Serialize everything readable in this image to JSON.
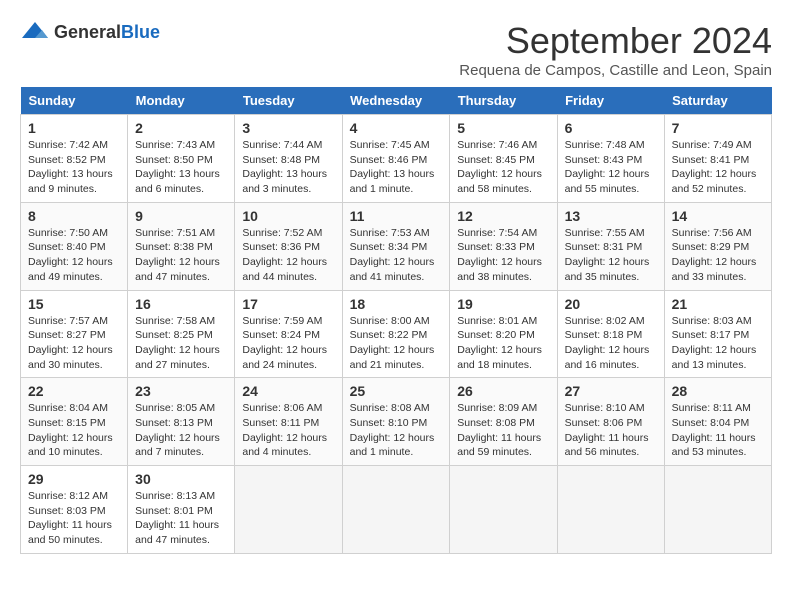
{
  "header": {
    "logo_general": "General",
    "logo_blue": "Blue",
    "month_title": "September 2024",
    "subtitle": "Requena de Campos, Castille and Leon, Spain"
  },
  "columns": [
    "Sunday",
    "Monday",
    "Tuesday",
    "Wednesday",
    "Thursday",
    "Friday",
    "Saturday"
  ],
  "weeks": [
    [
      {
        "day": "1",
        "sunrise": "7:42 AM",
        "sunset": "8:52 PM",
        "daylight": "13 hours and 9 minutes."
      },
      {
        "day": "2",
        "sunrise": "7:43 AM",
        "sunset": "8:50 PM",
        "daylight": "13 hours and 6 minutes."
      },
      {
        "day": "3",
        "sunrise": "7:44 AM",
        "sunset": "8:48 PM",
        "daylight": "13 hours and 3 minutes."
      },
      {
        "day": "4",
        "sunrise": "7:45 AM",
        "sunset": "8:46 PM",
        "daylight": "13 hours and 1 minute."
      },
      {
        "day": "5",
        "sunrise": "7:46 AM",
        "sunset": "8:45 PM",
        "daylight": "12 hours and 58 minutes."
      },
      {
        "day": "6",
        "sunrise": "7:48 AM",
        "sunset": "8:43 PM",
        "daylight": "12 hours and 55 minutes."
      },
      {
        "day": "7",
        "sunrise": "7:49 AM",
        "sunset": "8:41 PM",
        "daylight": "12 hours and 52 minutes."
      }
    ],
    [
      {
        "day": "8",
        "sunrise": "7:50 AM",
        "sunset": "8:40 PM",
        "daylight": "12 hours and 49 minutes."
      },
      {
        "day": "9",
        "sunrise": "7:51 AM",
        "sunset": "8:38 PM",
        "daylight": "12 hours and 47 minutes."
      },
      {
        "day": "10",
        "sunrise": "7:52 AM",
        "sunset": "8:36 PM",
        "daylight": "12 hours and 44 minutes."
      },
      {
        "day": "11",
        "sunrise": "7:53 AM",
        "sunset": "8:34 PM",
        "daylight": "12 hours and 41 minutes."
      },
      {
        "day": "12",
        "sunrise": "7:54 AM",
        "sunset": "8:33 PM",
        "daylight": "12 hours and 38 minutes."
      },
      {
        "day": "13",
        "sunrise": "7:55 AM",
        "sunset": "8:31 PM",
        "daylight": "12 hours and 35 minutes."
      },
      {
        "day": "14",
        "sunrise": "7:56 AM",
        "sunset": "8:29 PM",
        "daylight": "12 hours and 33 minutes."
      }
    ],
    [
      {
        "day": "15",
        "sunrise": "7:57 AM",
        "sunset": "8:27 PM",
        "daylight": "12 hours and 30 minutes."
      },
      {
        "day": "16",
        "sunrise": "7:58 AM",
        "sunset": "8:25 PM",
        "daylight": "12 hours and 27 minutes."
      },
      {
        "day": "17",
        "sunrise": "7:59 AM",
        "sunset": "8:24 PM",
        "daylight": "12 hours and 24 minutes."
      },
      {
        "day": "18",
        "sunrise": "8:00 AM",
        "sunset": "8:22 PM",
        "daylight": "12 hours and 21 minutes."
      },
      {
        "day": "19",
        "sunrise": "8:01 AM",
        "sunset": "8:20 PM",
        "daylight": "12 hours and 18 minutes."
      },
      {
        "day": "20",
        "sunrise": "8:02 AM",
        "sunset": "8:18 PM",
        "daylight": "12 hours and 16 minutes."
      },
      {
        "day": "21",
        "sunrise": "8:03 AM",
        "sunset": "8:17 PM",
        "daylight": "12 hours and 13 minutes."
      }
    ],
    [
      {
        "day": "22",
        "sunrise": "8:04 AM",
        "sunset": "8:15 PM",
        "daylight": "12 hours and 10 minutes."
      },
      {
        "day": "23",
        "sunrise": "8:05 AM",
        "sunset": "8:13 PM",
        "daylight": "12 hours and 7 minutes."
      },
      {
        "day": "24",
        "sunrise": "8:06 AM",
        "sunset": "8:11 PM",
        "daylight": "12 hours and 4 minutes."
      },
      {
        "day": "25",
        "sunrise": "8:08 AM",
        "sunset": "8:10 PM",
        "daylight": "12 hours and 1 minute."
      },
      {
        "day": "26",
        "sunrise": "8:09 AM",
        "sunset": "8:08 PM",
        "daylight": "11 hours and 59 minutes."
      },
      {
        "day": "27",
        "sunrise": "8:10 AM",
        "sunset": "8:06 PM",
        "daylight": "11 hours and 56 minutes."
      },
      {
        "day": "28",
        "sunrise": "8:11 AM",
        "sunset": "8:04 PM",
        "daylight": "11 hours and 53 minutes."
      }
    ],
    [
      {
        "day": "29",
        "sunrise": "8:12 AM",
        "sunset": "8:03 PM",
        "daylight": "11 hours and 50 minutes."
      },
      {
        "day": "30",
        "sunrise": "8:13 AM",
        "sunset": "8:01 PM",
        "daylight": "11 hours and 47 minutes."
      },
      null,
      null,
      null,
      null,
      null
    ]
  ]
}
